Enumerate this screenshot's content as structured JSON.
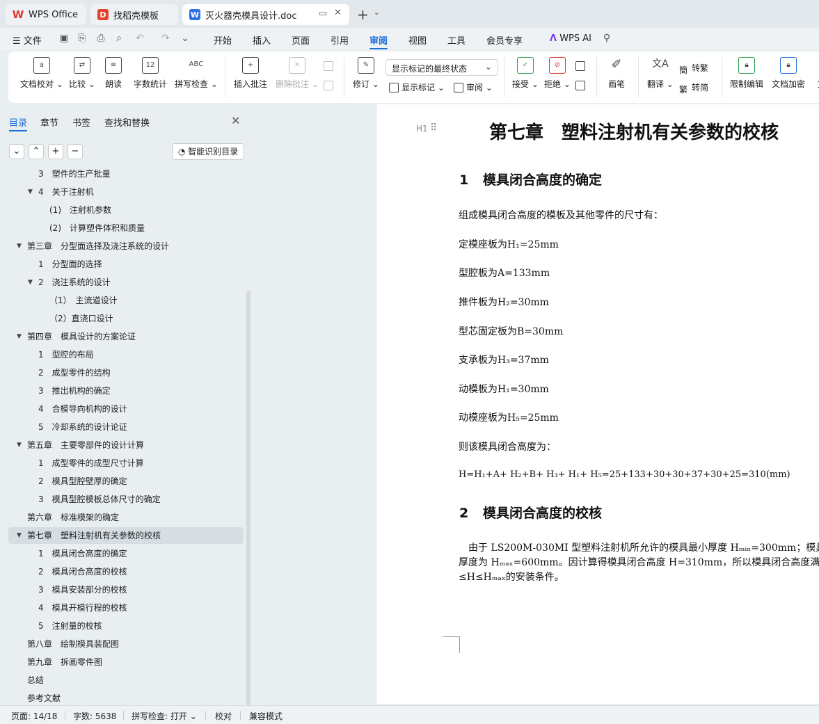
{
  "tabs": [
    {
      "label": "WPS Office",
      "icon": "wps-logo-icon"
    },
    {
      "label": "找稻壳模板",
      "icon": "docer-icon"
    },
    {
      "label": "灭火器壳模具设计.doc",
      "icon": "word-doc-icon",
      "active": true
    }
  ],
  "menu": {
    "file": "文件",
    "items": [
      "开始",
      "插入",
      "页面",
      "引用",
      "审阅",
      "视图",
      "工具",
      "会员专享"
    ],
    "active": "审阅",
    "wps_ai": "WPS AI"
  },
  "ribbon": {
    "doc_proofread": "文档校对",
    "compare": "比较",
    "read_aloud": "朗读",
    "word_count": "字数统计",
    "spell_check": "拼写检查",
    "insert_comment": "插入批注",
    "delete_comment": "删除批注",
    "revise": "修订",
    "display_state": "显示标记的最终状态",
    "show_markup": "显示标记",
    "review": "审阅",
    "accept": "接受",
    "reject": "拒绝",
    "pen": "画笔",
    "translate": "翻译",
    "to_traditional": "转繁",
    "to_simplified": "转简",
    "restrict_edit": "限制编辑",
    "doc_encrypt": "文档加密",
    "doc_partial": "文"
  },
  "nav": {
    "tabs": [
      "目录",
      "章节",
      "书签",
      "查找和替换"
    ],
    "active_tab": "目录",
    "smart_toc": "智能识别目录",
    "items": [
      {
        "text": "3　塑件的生产批量",
        "level": 2,
        "toggle": ""
      },
      {
        "text": "4　关于注射机",
        "level": 2,
        "toggle": "▼"
      },
      {
        "text": "(1)　注射机参数",
        "level": 3,
        "toggle": ""
      },
      {
        "text": "(2)　计算塑件体积和质量",
        "level": 3,
        "toggle": ""
      },
      {
        "text": "第三章　分型面选择及浇注系统的设计",
        "level": 1,
        "toggle": "▼"
      },
      {
        "text": "1　分型面的选择",
        "level": 2,
        "toggle": ""
      },
      {
        "text": "2　浇注系统的设计",
        "level": 2,
        "toggle": "▼"
      },
      {
        "text": "（1）　主流道设计",
        "level": 3,
        "toggle": ""
      },
      {
        "text": "（2）直浇口设计",
        "level": 3,
        "toggle": ""
      },
      {
        "text": "第四章　模具设计的方案论证",
        "level": 1,
        "toggle": "▼"
      },
      {
        "text": "1　型腔的布局",
        "level": 2,
        "toggle": ""
      },
      {
        "text": "2　成型零件的结构",
        "level": 2,
        "toggle": ""
      },
      {
        "text": "3　推出机构的确定",
        "level": 2,
        "toggle": ""
      },
      {
        "text": "4　合模导向机构的设计",
        "level": 2,
        "toggle": ""
      },
      {
        "text": "5　冷却系统的设计论证",
        "level": 2,
        "toggle": ""
      },
      {
        "text": "第五章　主要零部件的设计计算",
        "level": 1,
        "toggle": "▼"
      },
      {
        "text": "1　成型零件的成型尺寸计算",
        "level": 2,
        "toggle": ""
      },
      {
        "text": "2　模具型腔壁厚的确定",
        "level": 2,
        "toggle": ""
      },
      {
        "text": "3　模具型腔模板总体尺寸的确定",
        "level": 2,
        "toggle": ""
      },
      {
        "text": "第六章　标准模架的确定",
        "level": 1,
        "toggle": ""
      },
      {
        "text": "第七章　塑料注射机有关参数的校核",
        "level": 1,
        "toggle": "▼",
        "active": true
      },
      {
        "text": "1　模具闭合高度的确定",
        "level": 2,
        "toggle": ""
      },
      {
        "text": "2　模具闭合高度的校核",
        "level": 2,
        "toggle": ""
      },
      {
        "text": "3　模具安装部分的校核",
        "level": 2,
        "toggle": ""
      },
      {
        "text": "4　模具开模行程的校核",
        "level": 2,
        "toggle": ""
      },
      {
        "text": "5　注射量的校核",
        "level": 2,
        "toggle": ""
      },
      {
        "text": "第八章　绘制模具装配图",
        "level": 1,
        "toggle": ""
      },
      {
        "text": "第九章　拆画零件图",
        "level": 1,
        "toggle": ""
      },
      {
        "text": "总结",
        "level": 1,
        "toggle": ""
      },
      {
        "text": "参考文献",
        "level": 1,
        "toggle": ""
      }
    ]
  },
  "document": {
    "heading_mark": "H1",
    "chapter_title": "第七章　塑料注射机有关参数的校核",
    "section1": {
      "num": "1",
      "title": "模具闭合高度的确定"
    },
    "para_intro": "组成模具闭合高度的模板及其他零件的尺寸有：",
    "dims": [
      "定模座板为H₁=25mm",
      "型腔板为A=133mm",
      "推件板为H₂=30mm",
      "型芯固定板为B=30mm",
      "支承板为H₃=37mm",
      "动模板为H₁=30mm",
      "动模座板为H₅=25mm"
    ],
    "para_then": "则该模具闭合高度为：",
    "formula": "H=H₁+A+ H₂+B+ H₃+ H₁+ H₅=25+133+30+30+37+30+25=310(mm)",
    "section2": {
      "num": "2",
      "title": "模具闭合高度的校核"
    },
    "para2_line1": "　由于 LS200M-030MI 型塑料注射机所允许的模具最小厚度 Hₘᵢₙ=300mm；模具",
    "para2_line2": "厚度为 Hₘₐₓ=600mm。因计算得模具闭合高度 H=310mm，所以模具闭合高度满足",
    "para2_line3": "≤H≤Hₘₐₓ的安装条件。"
  },
  "status": {
    "page": "页面: 14/18",
    "words": "字数: 5638",
    "spell": "拼写检查: 打开",
    "proof": "校对",
    "compat": "兼容模式"
  },
  "colors": {
    "accent": "#1d6bd8",
    "wps_red": "#e2322b",
    "doc_blue": "#2f6fe6"
  }
}
